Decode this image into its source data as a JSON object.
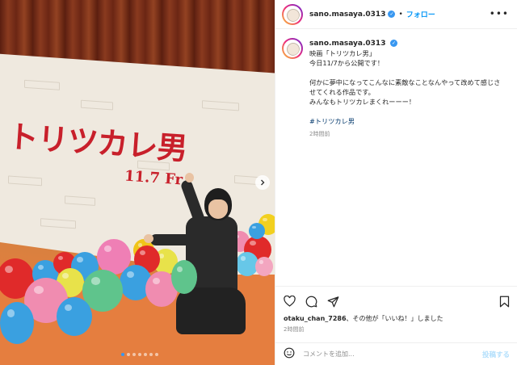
{
  "post": {
    "username": "sano.masaya.0313",
    "follow_label": "フォロー",
    "separator": "•",
    "more_label": "•••",
    "verified_badge": "✓",
    "caption_lines": [
      "映画「トリツカレ男」",
      "今日11/7から公開です！",
      "",
      "何かに夢中になってこんなに素敵なことなんやって改めて感じさ",
      "せてくれる作品です。",
      "みんなもトリツカレまくれーーー！"
    ],
    "hashtag": "#トリツカレ男",
    "caption_time": "2時間前",
    "likes_user": "otaku_chan_7286",
    "likes_rest": "、その他が「いいね！」しました",
    "posted_time": "2時間前",
    "comment_placeholder": "コメントを追加...",
    "post_button": "投稿する"
  },
  "image": {
    "sign_title": "トリツカレ男",
    "sign_date": "11.7 Fr",
    "carousel_count": 7,
    "carousel_active": 0,
    "next_icon": "chevron-right-icon"
  },
  "icons": {
    "like": "heart-icon",
    "comment": "comment-icon",
    "share": "share-icon",
    "save": "bookmark-icon",
    "emoji": "emoji-icon",
    "more": "more-icon",
    "verified": "verified-icon"
  },
  "colors": {
    "accent": "#0095f6",
    "verified": "#3897f0",
    "hashtag": "#00376b",
    "secondary_text": "#8e8e8e",
    "sign_red": "#c8202b"
  }
}
